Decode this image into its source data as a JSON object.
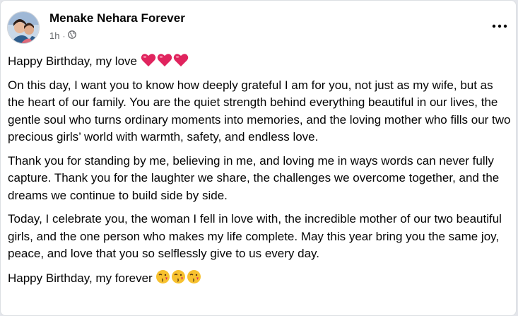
{
  "post": {
    "author": "Menake Nehara Forever",
    "time": "1h",
    "separator": "·",
    "audience_icon": "globe-icon",
    "menu_icon": "more-options-icon",
    "greeting": "Happy Birthday, my love",
    "greeting_emoji": [
      "❤️",
      "❤️",
      "❤️"
    ],
    "paragraphs": [
      "On this day, I want you to know how deeply grateful I am for you, not just as my wife, but as the heart of our family. You are the quiet strength behind everything beautiful in our lives, the gentle soul who turns ordinary moments into memories, and the loving mother who fills our two precious girls’ world with warmth, safety, and endless love.",
      "Thank you for standing by me, believing in me, and loving me in ways words can never fully capture. Thank you for the laughter we share, the challenges we overcome together, and the dreams we continue to build side by side.",
      "Today, I celebrate you, the woman I fell in love with, the incredible mother of our two beautiful girls, and the one person who makes my life complete. May this year bring you the same joy, peace, and love that you so selflessly give to us every day."
    ],
    "closing": "Happy Birthday, my forever",
    "closing_emoji": [
      "😘",
      "😘",
      "😘"
    ]
  },
  "colors": {
    "text": "#050505",
    "secondary_text": "#65676b",
    "heart": "#e0245e",
    "emoji_face": "#f7c12f"
  }
}
